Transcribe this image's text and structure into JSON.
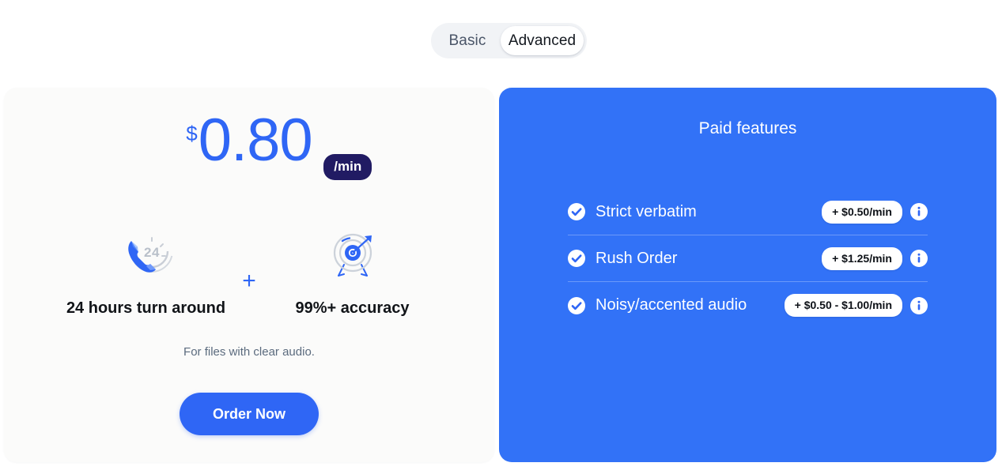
{
  "toggle": {
    "options": [
      {
        "label": "Basic",
        "active": false
      },
      {
        "label": "Advanced",
        "active": true
      }
    ]
  },
  "pricing_card": {
    "currency_symbol": "$",
    "amount": "0.80",
    "unit_badge": "/min",
    "features": [
      {
        "icon": "phone-24-hours-icon",
        "caption": "24 hours turn around"
      },
      {
        "icon": "target-accuracy-icon",
        "caption": "99%+ accuracy"
      }
    ],
    "separator": "+",
    "note": "For files with clear audio.",
    "cta_label": "Order Now"
  },
  "paid_features": {
    "title": "Paid features",
    "rows": [
      {
        "check_icon": "check-circle-icon",
        "label": "Strict verbatim",
        "price": "+ $0.50/min",
        "info_icon": "info-circle-icon"
      },
      {
        "check_icon": "check-circle-icon",
        "label": "Rush Order",
        "price": "+ $1.25/min",
        "info_icon": "info-circle-icon"
      },
      {
        "check_icon": "check-circle-icon",
        "label": "Noisy/accented audio",
        "price": "+ $0.50 - $1.00/min",
        "info_icon": "info-circle-icon"
      }
    ]
  },
  "colors": {
    "brand_blue": "#2f66f5",
    "panel_blue": "#3272f7",
    "badge_navy": "#211b63",
    "page_bg": "#ffffff",
    "card_bg": "#fbfbfa"
  }
}
